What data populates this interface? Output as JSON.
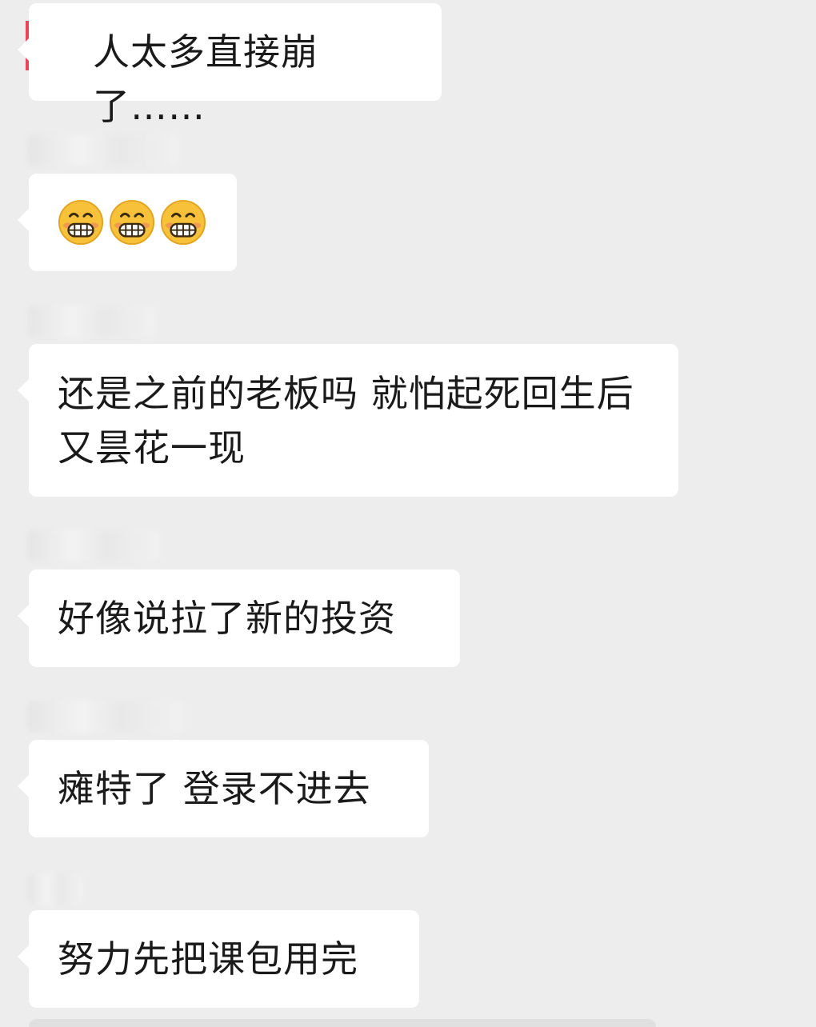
{
  "messages": [
    {
      "text": "人太多直接崩了……"
    },
    {
      "emojis": [
        "grinning-face-icon",
        "grinning-face-icon",
        "grinning-face-icon"
      ]
    },
    {
      "text": "还是之前的老板吗 就怕起死回生后又昙花一现"
    },
    {
      "text": "好像说拉了新的投资"
    },
    {
      "text": "瘫特了 登录不进去"
    },
    {
      "text": "努力先把课包用完"
    }
  ],
  "colors": {
    "background": "#ededed",
    "bubble": "#ffffff",
    "text": "#1a1a1a",
    "logo_accent": "#e8445a"
  }
}
